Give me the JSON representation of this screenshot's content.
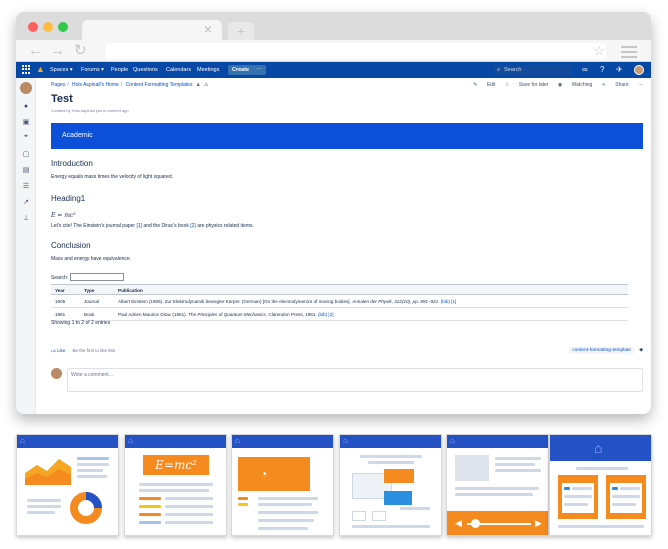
{
  "browser": {
    "tab_close": "×",
    "newtab": "+",
    "back": "←",
    "forward": "→",
    "reload": "↻",
    "star": "☆"
  },
  "topnav": {
    "spaces": "Spaces ▾",
    "forums": "Forums ▾",
    "people": "People",
    "questions": "Questions",
    "calendars": "Calendars",
    "meetings": "Meetings",
    "create": "Create",
    "more": "···",
    "search_placeholder": "Search"
  },
  "page": {
    "breadcrumb": [
      "Pages",
      "Hols Aspinall's Home",
      "Content Formatting Templates"
    ],
    "actions": {
      "edit": "Edit",
      "save": "Save for later",
      "watching": "Watching",
      "share": "Share",
      "more": "···"
    },
    "title": "Test",
    "byline": "Created by Hols Aspinall just a moment ago",
    "banner": "Academic",
    "intro_heading": "Introduction",
    "intro_text": "Energy equals mass times the velocity of light squared.",
    "heading1": "Heading1",
    "formula": "E = mc²",
    "cite_text_1": "Let's cite! The Einstein's journal paper ",
    "cite_ref_1": "[1]",
    "cite_text_2": " and the Dirac's book ",
    "cite_ref_2": "[2]",
    "cite_text_3": " are physics related items.",
    "conclusion_heading": "Conclusion",
    "conclusion_text": "Mass and energy have equivalence.",
    "search_label": "Search:",
    "table": {
      "headers": [
        "Year",
        "Type",
        "Publication"
      ],
      "rows": [
        {
          "year": "1905",
          "type": "Journal",
          "pub_a": "Albert Einstein (1905). Zur Elektrodynamik bewegter Körper. (German) [On the electrodynamics of moving bodies]. ",
          "pub_b": "Annalen der Physik, 322(10), pp. 891–921.",
          "pub_link": " (bib) [1]"
        },
        {
          "year": "1981",
          "type": "Book",
          "pub_a": "Paul Adrien Maurice Dirac (1981). ",
          "pub_b": "The Principles of Quantum Mechanics,",
          "pub_c": " Clarendon Press, 1981.",
          "pub_link": " (bib) [2]"
        }
      ]
    },
    "showing": "Showing 1 to 2 of 2 entries",
    "like": "Like",
    "like_hint": "Be the first to like this",
    "label": "content-formatting-template",
    "comment_placeholder": "Write a comment..."
  },
  "colors": {
    "nav": "#0747a6",
    "banner": "#0c4fd8",
    "link": "#0052cc",
    "thumb_header": "#2452c4",
    "accent_orange": "#f58a1f"
  }
}
